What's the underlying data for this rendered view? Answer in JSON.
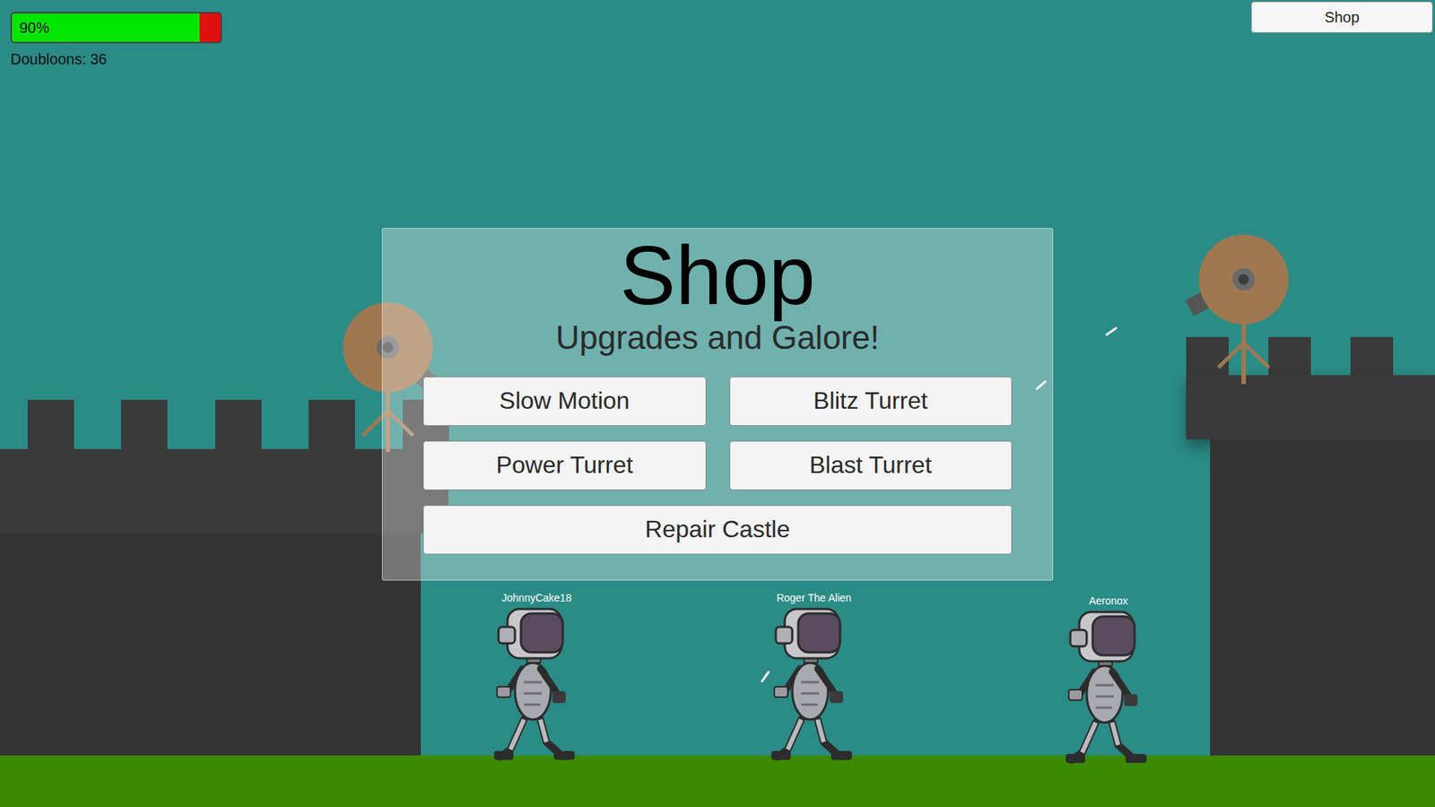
{
  "hud": {
    "health": {
      "reading": "90%",
      "level": 0.9
    },
    "currency": "Doubloons: 36",
    "shop_button": "Shop"
  },
  "shop": {
    "title": "Shop",
    "subtitle": "Upgrades and Galore!",
    "items": [
      {
        "label": "Slow Motion",
        "kind": "half"
      },
      {
        "label": "Blitz Turret",
        "kind": "half"
      },
      {
        "label": "Power Turret",
        "kind": "half"
      },
      {
        "label": "Blast Turret",
        "kind": "half"
      },
      {
        "label": "Repair Castle",
        "kind": "wide"
      }
    ]
  },
  "enemies": [
    {
      "name": "JohnnyCake18"
    },
    {
      "name": "Roger The Alien"
    },
    {
      "name": "Aeronox"
    }
  ]
}
